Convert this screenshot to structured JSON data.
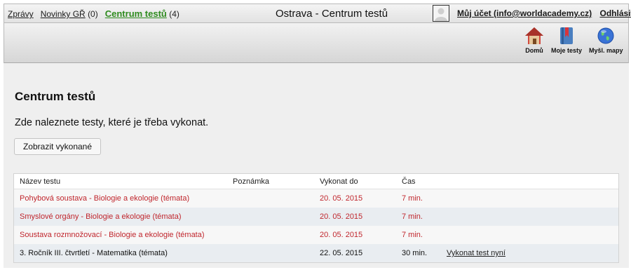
{
  "topbar": {
    "zpravy": "Zprávy",
    "novinky": "Novinky GŘ",
    "novinky_count": "(0)",
    "centrum": "Centrum testů",
    "centrum_count": "(4)",
    "title": "Ostrava - Centrum testů",
    "account": "Můj účet (info@worldacademy.cz)",
    "logout": "Odhlásit"
  },
  "toolbar": {
    "home": "Domů",
    "my_tests": "Moje testy",
    "mind_maps": "Myšl. mapy"
  },
  "main": {
    "heading": "Centrum testů",
    "description": "Zde naleznete testy, které je třeba vykonat.",
    "show_completed": "Zobrazit vykonané"
  },
  "table": {
    "headers": [
      "Název testu",
      "Poznámka",
      "Vykonat do",
      "Čas"
    ],
    "rows": [
      {
        "name": "Pohybová soustava - Biologie a ekologie (témata)",
        "note": "",
        "due": "20. 05. 2015",
        "time": "7 min.",
        "action": ""
      },
      {
        "name": "Smyslové orgány - Biologie a ekologie (témata)",
        "note": "",
        "due": "20. 05. 2015",
        "time": "7 min.",
        "action": ""
      },
      {
        "name": "Soustava rozmnožovací - Biologie a ekologie (témata)",
        "note": "",
        "due": "20. 05. 2015",
        "time": "7 min.",
        "action": ""
      },
      {
        "name": "3. Ročník III. čtvrtletí - Matematika (témata)",
        "note": "",
        "due": "22. 05. 2015",
        "time": "30 min.",
        "action": "Vykonat test nyní"
      }
    ]
  },
  "colors": {
    "overdue": "#c0262d",
    "active_nav": "#2e8b1e",
    "content_bg": "#efefef"
  },
  "icons": [
    "house-icon",
    "book-icon",
    "globe-icon",
    "user-avatar"
  ]
}
